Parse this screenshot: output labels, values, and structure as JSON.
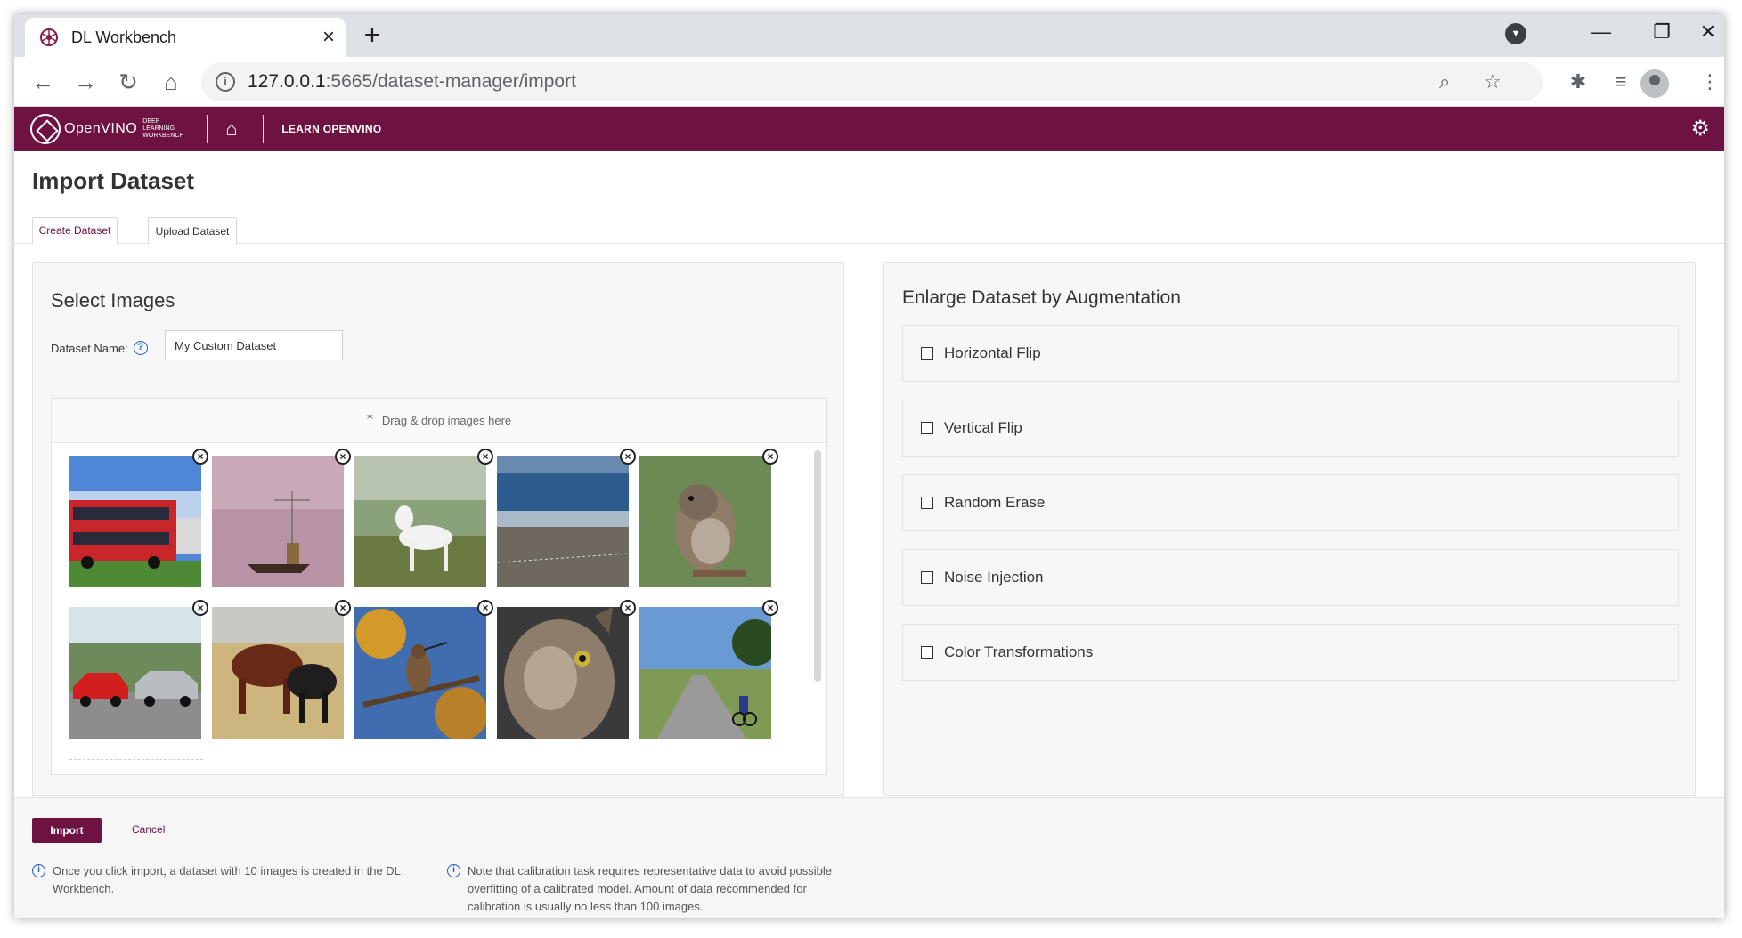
{
  "browser": {
    "tab_title": "DL Workbench",
    "url_host": "127.0.0.1",
    "url_path": ":5665/dataset-manager/import"
  },
  "appbar": {
    "logo_text": "OpenVINO",
    "logo_sub": "DEEP LEARNING WORKBENCH",
    "learn_label": "LEARN OPENVINO"
  },
  "page": {
    "title": "Import Dataset",
    "tabs": [
      {
        "label": "Create Dataset"
      },
      {
        "label": "Upload Dataset"
      }
    ]
  },
  "select_images": {
    "title": "Select Images",
    "dataset_name_label": "Dataset Name:",
    "dataset_name_value": "My Custom Dataset",
    "drop_hint": "Drag & drop images here",
    "images": [
      {
        "subject": "red double-decker bus"
      },
      {
        "subject": "boat on water"
      },
      {
        "subject": "white dog in grass"
      },
      {
        "subject": "beach shoreline"
      },
      {
        "subject": "sparrow"
      },
      {
        "subject": "red and silver cars"
      },
      {
        "subject": "bull and calf"
      },
      {
        "subject": "hummingbird on branch"
      },
      {
        "subject": "cat close-up"
      },
      {
        "subject": "cyclist on road"
      }
    ]
  },
  "augmentation": {
    "title": "Enlarge Dataset by Augmentation",
    "options": [
      {
        "label": "Horizontal Flip"
      },
      {
        "label": "Vertical Flip"
      },
      {
        "label": "Random Erase"
      },
      {
        "label": "Noise Injection"
      },
      {
        "label": "Color Transformations"
      }
    ]
  },
  "footer": {
    "import_label": "Import",
    "cancel_label": "Cancel",
    "note_1": "Once you click import, a dataset with 10 images is created in the DL Workbench.",
    "note_2": "Note that calibration task requires representative data to avoid possible overfitting of a calibrated model. Amount of data recommended for calibration is usually no less than 100 images."
  },
  "colors": {
    "brand": "#6e1241",
    "accent_blue": "#1a5cd6"
  }
}
